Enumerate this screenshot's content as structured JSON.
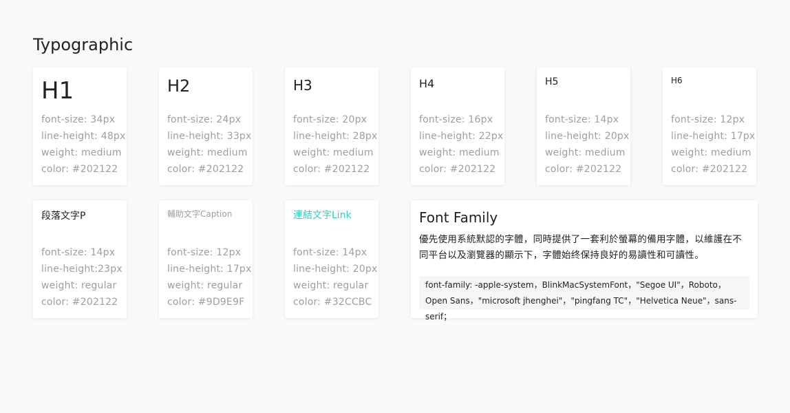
{
  "page": {
    "title": "Typographic"
  },
  "headings": [
    {
      "sample": "H1",
      "specs": [
        "font-size: 34px",
        "line-height: 48px",
        "weight: medium",
        "color: #202122"
      ]
    },
    {
      "sample": "H2",
      "specs": [
        "font-size: 24px",
        "line-height: 33px",
        "weight: medium",
        "color: #202122"
      ]
    },
    {
      "sample": "H3",
      "specs": [
        "font-size: 20px",
        "line-height: 28px",
        "weight: medium",
        "color: #202122"
      ]
    },
    {
      "sample": "H4",
      "specs": [
        "font-size: 16px",
        "line-height: 22px",
        "weight: medium",
        "color: #202122"
      ]
    },
    {
      "sample": "H5",
      "specs": [
        "font-size: 14px",
        "line-height: 20px",
        "weight: medium",
        "color: #202122"
      ]
    },
    {
      "sample": "H6",
      "specs": [
        "font-size: 12px",
        "line-height: 17px",
        "weight: medium",
        "color: #202122"
      ]
    }
  ],
  "text_styles": [
    {
      "sample": "段落文字P",
      "specs": [
        "font-size: 14px",
        "line-height:23px",
        "weight: regular",
        "color: #202122"
      ]
    },
    {
      "sample": "輔助文字Caption",
      "specs": [
        "font-size: 12px",
        "line-height: 17px",
        "weight: regular",
        "color: #9D9E9F"
      ]
    },
    {
      "sample": "連結文字Link",
      "specs": [
        "font-size: 14px",
        "line-height: 20px",
        "weight: regular",
        "color: #32CCBC"
      ]
    }
  ],
  "font_family": {
    "title": "Font Family",
    "description": "優先使用系統默認的字體，同時提供了一套利於螢幕的備用字體，以維護在不同平台以及瀏覽器的顯示下，字體始终保持良好的易讀性和可讀性。",
    "code": "font-family:  -apple-system，BlinkMacSystemFont，\"Segoe UI\"，Roboto，Open Sans，\"microsoft jhenghei\"，\"pingfang TC\"，\"Helvetica Neue\"，sans-serif；"
  },
  "colors": {
    "text": "#202122",
    "caption": "#9D9E9F",
    "link": "#32CCBC",
    "background": "#F9F9F9",
    "card": "#FFFFFF"
  }
}
